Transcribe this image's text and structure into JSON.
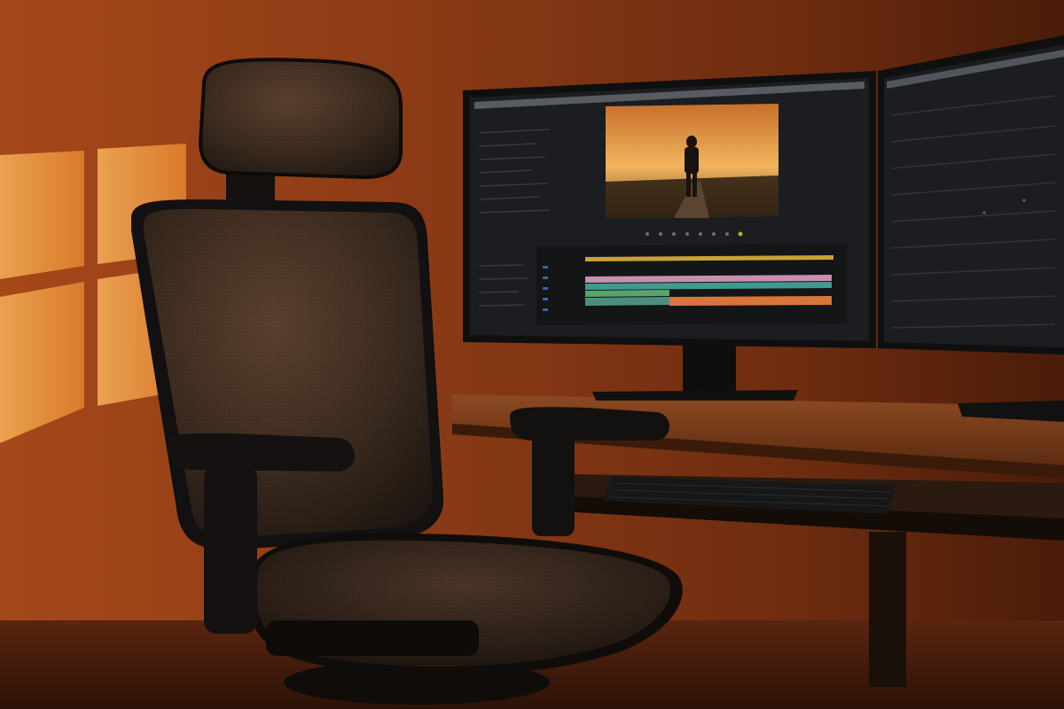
{
  "scene": {
    "subject": "ergonomic-mesh-office-chair",
    "setting": "desk-with-dual-monitors-at-sunset",
    "colors": {
      "wall_dark": "#5a2510",
      "wall_mid": "#8a3d17",
      "wall_light": "#c9611f",
      "sun_patch": "#f2a54a",
      "chair_mesh": "#3b2a1d",
      "chair_frame": "#141110",
      "desk_top": "#7a3f1c",
      "desk_edge": "#4a230e",
      "monitor_bezel": "#121212",
      "monitor_screen": "#1a1c1f",
      "preview_sky_top": "#e08a35",
      "preview_sky_bottom": "#f7c36a",
      "timeline_yellow": "#c9a235",
      "timeline_pink": "#c98fb0",
      "timeline_teal": "#3f9b8e",
      "timeline_green": "#5aa36a",
      "timeline_orange": "#d8753a"
    },
    "icons": [
      "video-preview-icon",
      "timeline-icon",
      "keyboard-icon"
    ]
  }
}
